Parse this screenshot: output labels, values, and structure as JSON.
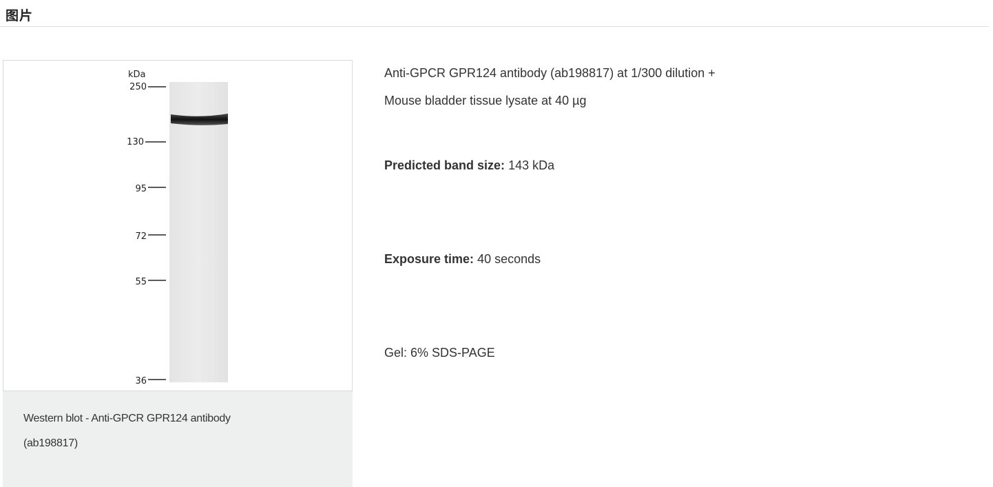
{
  "section": {
    "title": "图片"
  },
  "figure": {
    "blot": {
      "unit_label": "kDa",
      "markers": [
        "250",
        "130",
        "95",
        "72",
        "55",
        "36"
      ]
    },
    "caption_line1": "Western blot - Anti-GPCR GPR124 antibody",
    "caption_line2": "(ab198817)"
  },
  "details": {
    "antibody_line": "Anti-GPCR GPR124 antibody (ab198817) at 1/300 dilution +",
    "lysate_line": "Mouse bladder tissue lysate at 40 µg",
    "band_label": "Predicted band size:",
    "band_value": "143 kDa",
    "exposure_label": "Exposure time:",
    "exposure_value": "40 seconds",
    "gel_line": "Gel: 6% SDS-PAGE"
  }
}
